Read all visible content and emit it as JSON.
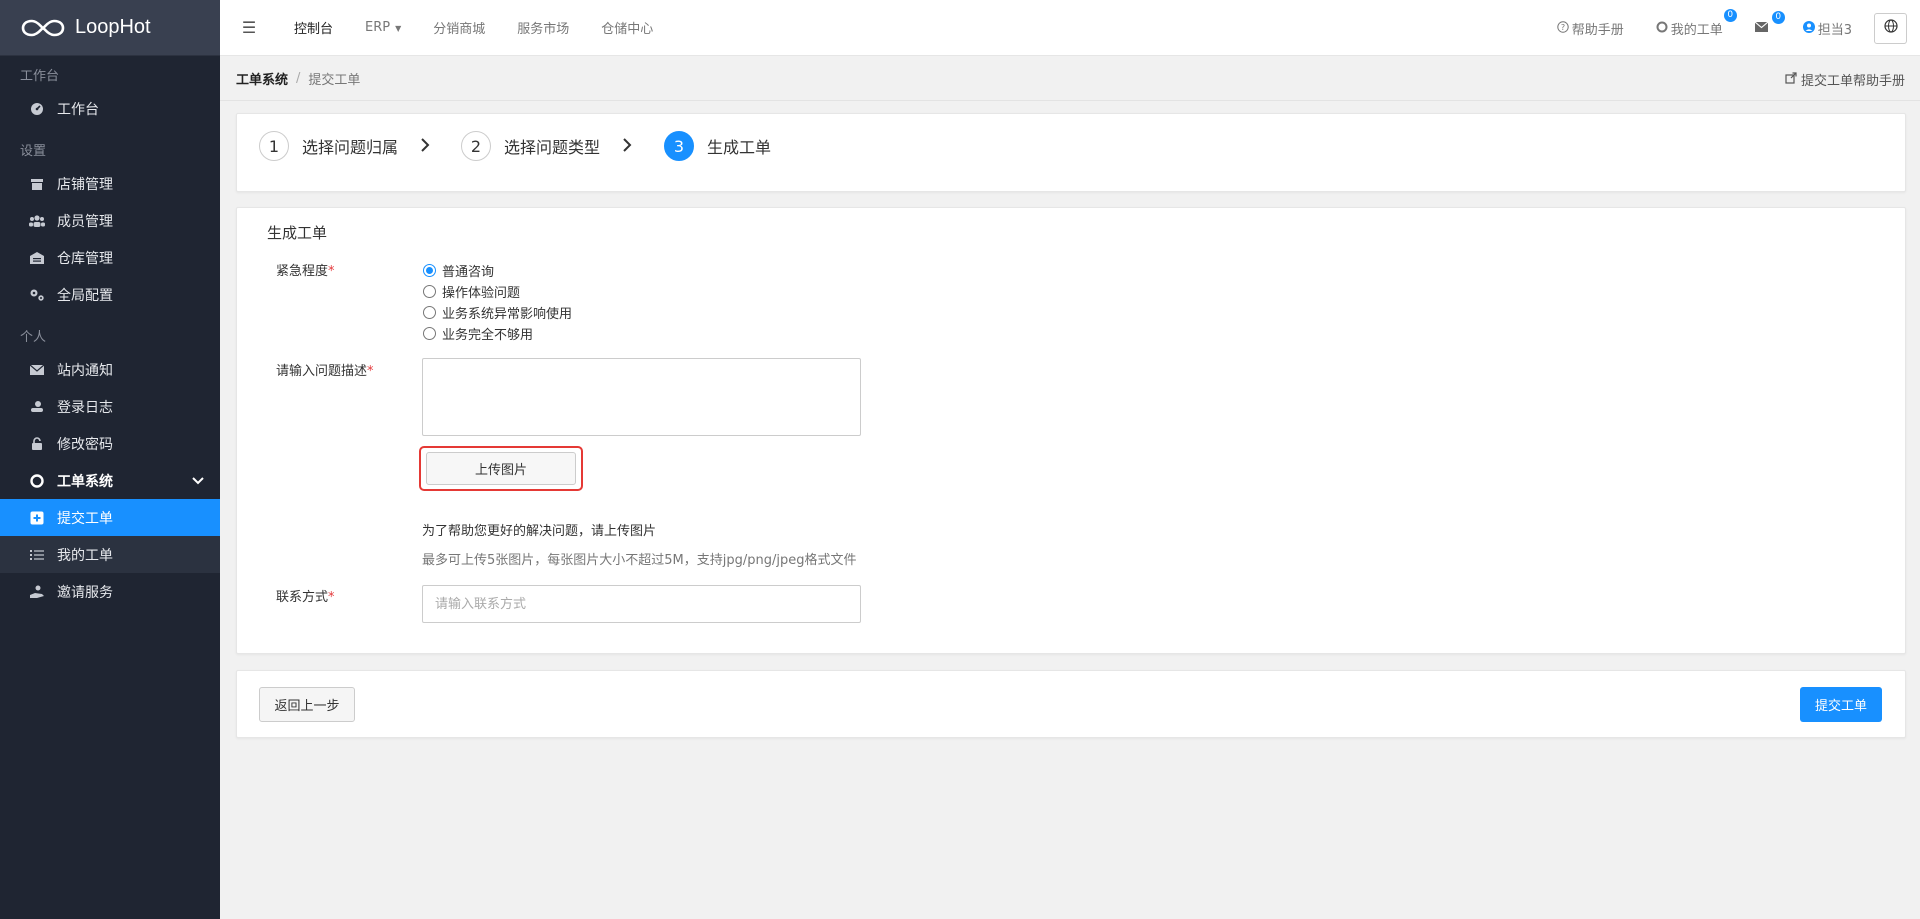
{
  "app": {
    "name": "LoopHot"
  },
  "sidebar": {
    "sections": [
      {
        "title": "工作台",
        "items": [
          {
            "label": "工作台",
            "icon": "dashboard-icon"
          }
        ]
      },
      {
        "title": "设置",
        "items": [
          {
            "label": "店铺管理",
            "icon": "store-icon"
          },
          {
            "label": "成员管理",
            "icon": "users-icon"
          },
          {
            "label": "仓库管理",
            "icon": "warehouse-icon"
          },
          {
            "label": "全局配置",
            "icon": "cogs-icon"
          }
        ]
      },
      {
        "title": "个人",
        "items": [
          {
            "label": "站内通知",
            "icon": "envelope-icon"
          },
          {
            "label": "登录日志",
            "icon": "log-icon"
          },
          {
            "label": "修改密码",
            "icon": "unlock-icon"
          },
          {
            "label": "工单系统",
            "icon": "lifebuoy-icon"
          },
          {
            "label": "提交工单",
            "icon": "plus-square-icon"
          },
          {
            "label": "我的工单",
            "icon": "list-icon"
          },
          {
            "label": "邀请服务",
            "icon": "hand-icon"
          }
        ]
      }
    ]
  },
  "topnav": {
    "items": [
      "控制台",
      "ERP",
      "分销商城",
      "服务市场",
      "仓储中心"
    ],
    "right": {
      "help": "帮助手册",
      "my_tickets": "我的工单",
      "my_tickets_badge": "0",
      "mail_badge": "0",
      "user": "担当3"
    }
  },
  "breadcrumb": {
    "root": "工单系统",
    "current": "提交工单",
    "help_link": "提交工单帮助手册"
  },
  "steps": [
    {
      "num": "1",
      "label": "选择问题归属"
    },
    {
      "num": "2",
      "label": "选择问题类型"
    },
    {
      "num": "3",
      "label": "生成工单"
    }
  ],
  "form": {
    "title": "生成工单",
    "urgency_label": "紧急程度",
    "urgency_options": [
      "普通咨询",
      "操作体验问题",
      "业务系统异常影响使用",
      "业务完全不够用"
    ],
    "urgency_selected": 0,
    "description_label": "请输入问题描述",
    "upload_label": "上传图片",
    "tip_main": "为了帮助您更好的解决问题，请上传图片",
    "tip_sub": "最多可上传5张图片，每张图片大小不超过5M，支持jpg/png/jpeg格式文件",
    "contact_label": "联系方式",
    "contact_placeholder": "请输入联系方式",
    "required_mark": "*"
  },
  "actions": {
    "back": "返回上一步",
    "submit": "提交工单"
  },
  "colors": {
    "accent": "#1890ff",
    "sidebar_bg": "#1f2532",
    "highlight": "#e53935"
  }
}
